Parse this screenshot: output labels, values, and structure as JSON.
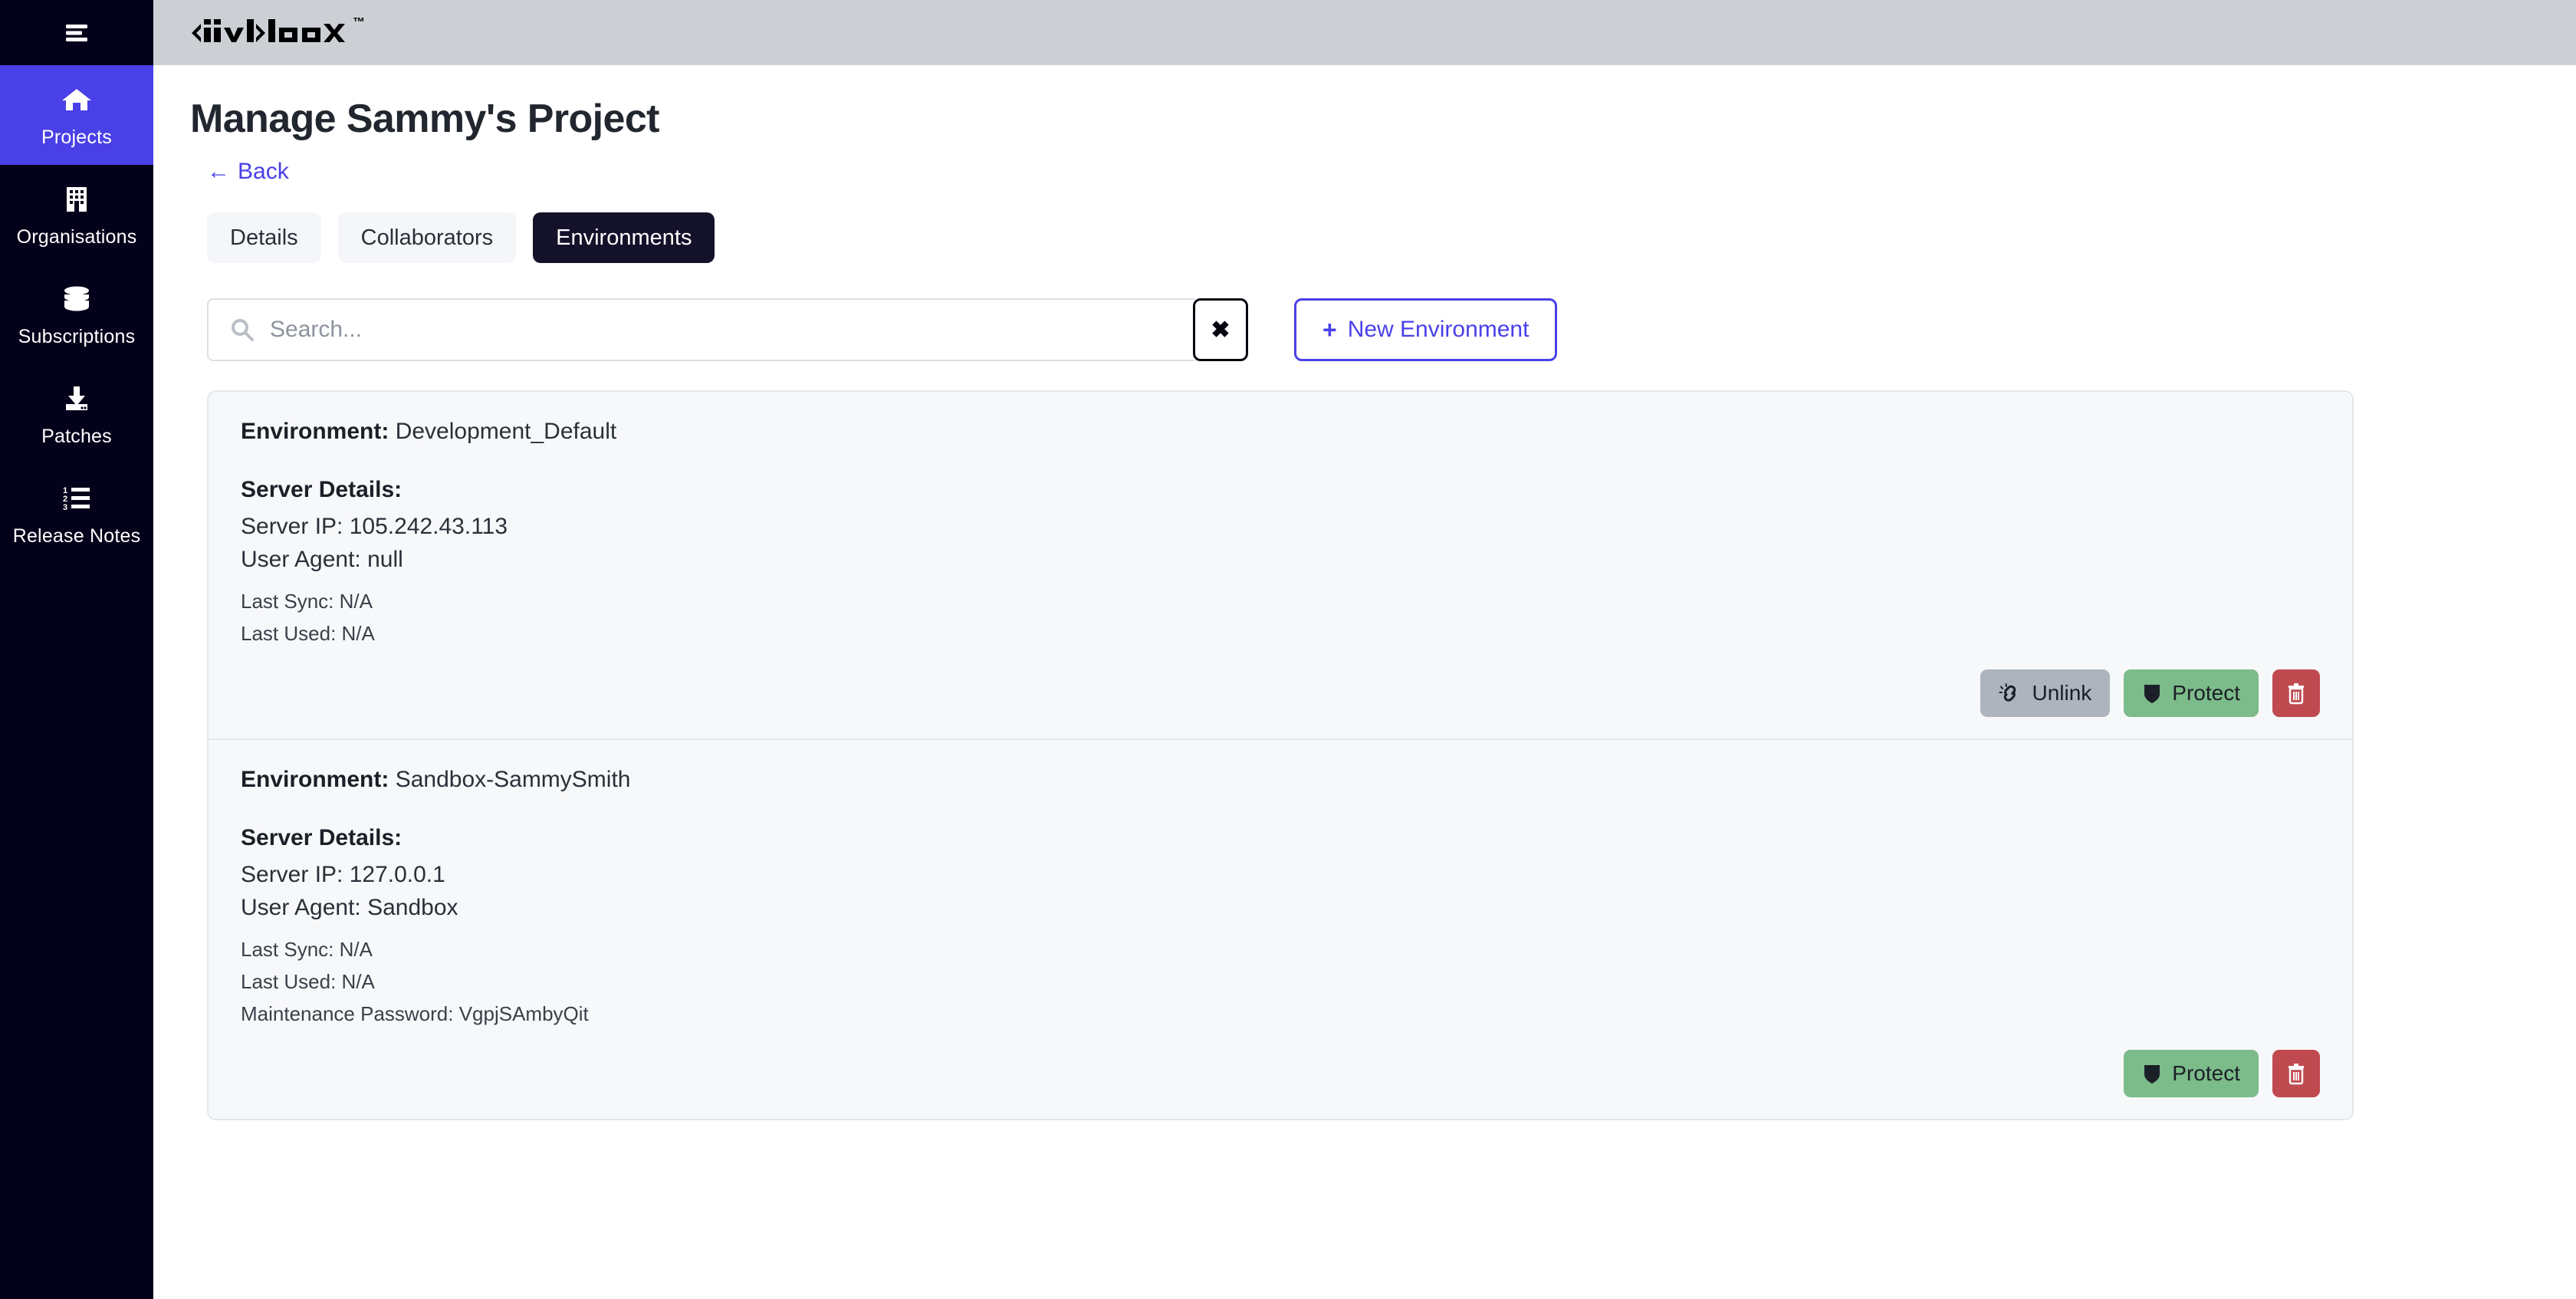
{
  "sidebar": {
    "toggle_icon": "hamburger-menu-icon",
    "items": [
      {
        "label": "Projects",
        "icon": "home-icon",
        "active": true
      },
      {
        "label": "Organisations",
        "icon": "building-icon",
        "active": false
      },
      {
        "label": "Subscriptions",
        "icon": "database-icon",
        "active": false
      },
      {
        "label": "Patches",
        "icon": "download-icon",
        "active": false
      },
      {
        "label": "Release Notes",
        "icon": "ordered-list-icon",
        "active": false
      }
    ]
  },
  "topbar": {
    "logo_text": "divblox",
    "logo_trademark": "™"
  },
  "page": {
    "title": "Manage Sammy's Project",
    "back_label": "Back",
    "back_arrow": "←"
  },
  "tabs": [
    {
      "label": "Details",
      "active": false
    },
    {
      "label": "Collaborators",
      "active": false
    },
    {
      "label": "Environments",
      "active": true
    }
  ],
  "toolbar": {
    "search_placeholder": "Search...",
    "search_value": "",
    "clear_label": "✖",
    "new_environment_label": "New Environment",
    "new_environment_plus": "+"
  },
  "labels": {
    "environment_label": "Environment:",
    "server_details_heading": "Server Details:",
    "unlink": "Unlink",
    "protect": "Protect"
  },
  "environments": [
    {
      "name": "Development_Default",
      "server_ip": "Server IP: 105.242.43.113",
      "user_agent": "User Agent: null",
      "last_sync": "Last Sync: N/A",
      "last_used": "Last Used: N/A",
      "maintenance_password": null,
      "has_unlink": true
    },
    {
      "name": "Sandbox-SammySmith",
      "server_ip": "Server IP: 127.0.0.1",
      "user_agent": "User Agent: Sandbox",
      "last_sync": "Last Sync: N/A",
      "last_used": "Last Used: N/A",
      "maintenance_password": "Maintenance Password: VgpjSAmbyQit",
      "has_unlink": false
    }
  ],
  "colors": {
    "sidebar_bg": "#04021a",
    "accent_indigo": "#4a40e8",
    "topbar_bg": "#ccd0d5",
    "tab_active_bg": "#14112a",
    "card_bg": "#f7f8fa",
    "protect_green": "#7cbb8a",
    "delete_red": "#bf4a4f",
    "unlink_gray": "#adb4bd"
  }
}
